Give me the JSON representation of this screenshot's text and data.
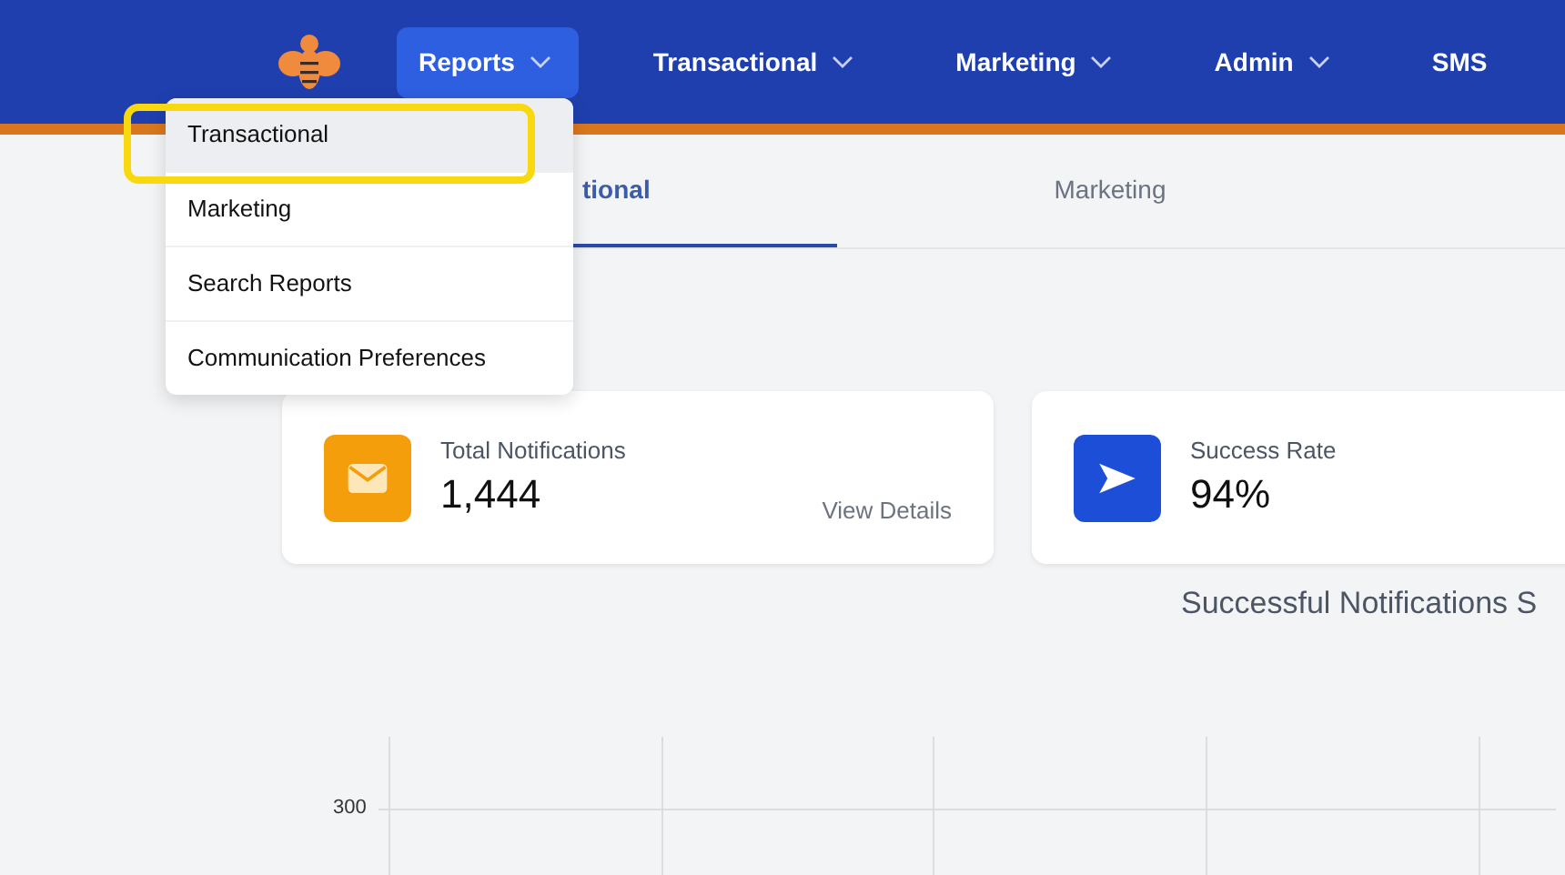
{
  "nav": {
    "items": [
      {
        "label": "Reports",
        "dropdown": true,
        "selected": true
      },
      {
        "label": "Transactional",
        "dropdown": true,
        "selected": false
      },
      {
        "label": "Marketing",
        "dropdown": true,
        "selected": false
      },
      {
        "label": "Admin",
        "dropdown": true,
        "selected": false
      },
      {
        "label": "SMS",
        "dropdown": false,
        "selected": false
      }
    ]
  },
  "menu": {
    "items": [
      {
        "label": "Transactional",
        "selected": true,
        "highlighted": true
      },
      {
        "label": "Marketing",
        "selected": false,
        "highlighted": false
      },
      {
        "label": "Search Reports",
        "selected": false,
        "highlighted": false
      },
      {
        "label": "Communication Preferences",
        "selected": false,
        "highlighted": false
      }
    ]
  },
  "tabs": [
    {
      "label": "tional",
      "selected": true
    },
    {
      "label": "Marketing",
      "selected": false
    }
  ],
  "stats": [
    {
      "kind": "mail",
      "title": "Total Notifications",
      "value": "1,444",
      "link": "View Details"
    },
    {
      "kind": "send",
      "title": "Success Rate",
      "value": "94%"
    }
  ],
  "chart": {
    "title": "Successful Notifications S",
    "ytick": "300"
  }
}
